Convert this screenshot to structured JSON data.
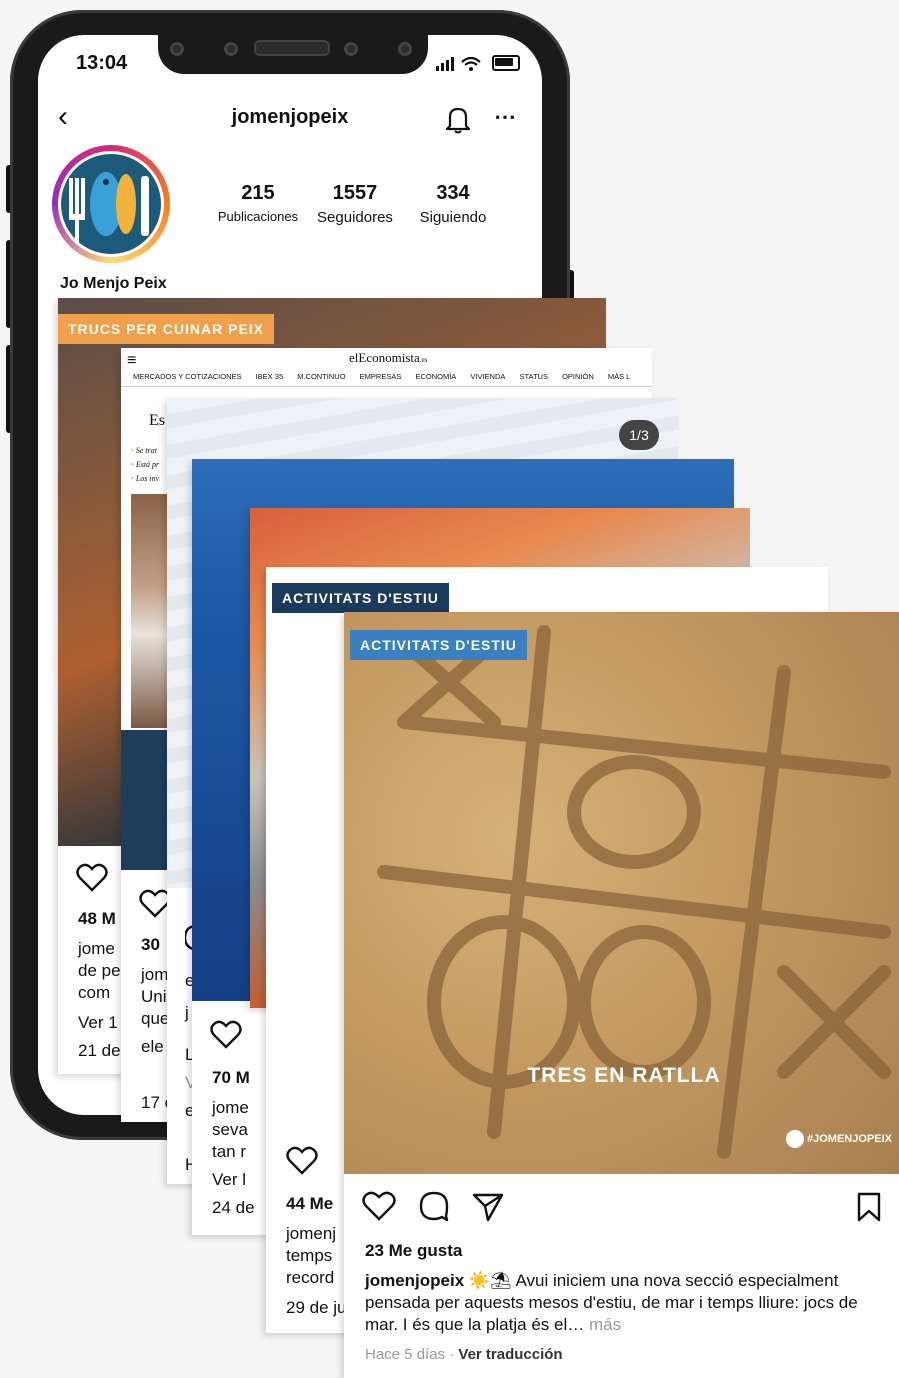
{
  "status": {
    "time": "13:04"
  },
  "profile": {
    "username": "jomenjopeix",
    "display_name": "Jo Menjo Peix",
    "stats": [
      {
        "value": "215",
        "label": "Publicaciones"
      },
      {
        "value": "1557",
        "label": "Seguidores"
      },
      {
        "value": "334",
        "label": "Siguiendo"
      }
    ]
  },
  "cards": {
    "c1": {
      "tag": "TRUCS PER CUINAR PEIX",
      "likes": "48 M",
      "lines": [
        "jome",
        "de pe",
        "com"
      ],
      "more": "Ver 1",
      "date": "21 de"
    },
    "c2": {
      "site": "elEconomista",
      "site_suffix": ".es",
      "nav": [
        "MERCADOS Y COTIZACIONES",
        "IBEX 35",
        "M.CONTINUO",
        "EMPRESAS",
        "ECONOMÍA",
        "VIVIENDA",
        "STATUS",
        "OPINIÓN",
        "MÁS L"
      ],
      "headline": "Es",
      "bullets": [
        "Se trat",
        "Está pr",
        "Los inv"
      ],
      "likes": "30",
      "lines": [
        "jom",
        "Uni",
        "que"
      ],
      "extra": "ele",
      "date": "17 c"
    },
    "c3": {
      "counter": "1/3",
      "line1": "e",
      "line2": "j",
      "line3": "L",
      "line4": "V",
      "line5": "e",
      "line6": "H"
    },
    "c4": {
      "likes": "70 M",
      "lines": [
        "jome",
        "seva",
        "tan r"
      ],
      "more": "Ver l",
      "date": "24 de"
    },
    "c5": {
      "tag": "ACTIVITATS D'ESTIU",
      "likes": "44 Me",
      "lines": [
        "jomenj",
        "temps",
        "record"
      ],
      "date": "29 de ju"
    },
    "c6": {
      "tag": "ACTIVITATS D'ESTIU",
      "image_title": "TRES EN RATLLA",
      "watermark": "#JOMENJOPEIX",
      "likes": "23 Me gusta",
      "username": "jomenjopeix",
      "emoji": "☀️⛱",
      "caption": " Avui iniciem una nova secció especialment pensada per aquests mesos d'estiu, de mar i temps lliure: jocs de mar. I és que la platja és el…",
      "more": "más",
      "time": "Hace 5 días",
      "translate": "Ver traducción"
    }
  },
  "colors": {
    "tag_orange": "#f0a04b",
    "tag_navy": "#1a3b5c",
    "tag_blue": "#3a7fbf",
    "sand": "#c8a06a"
  }
}
